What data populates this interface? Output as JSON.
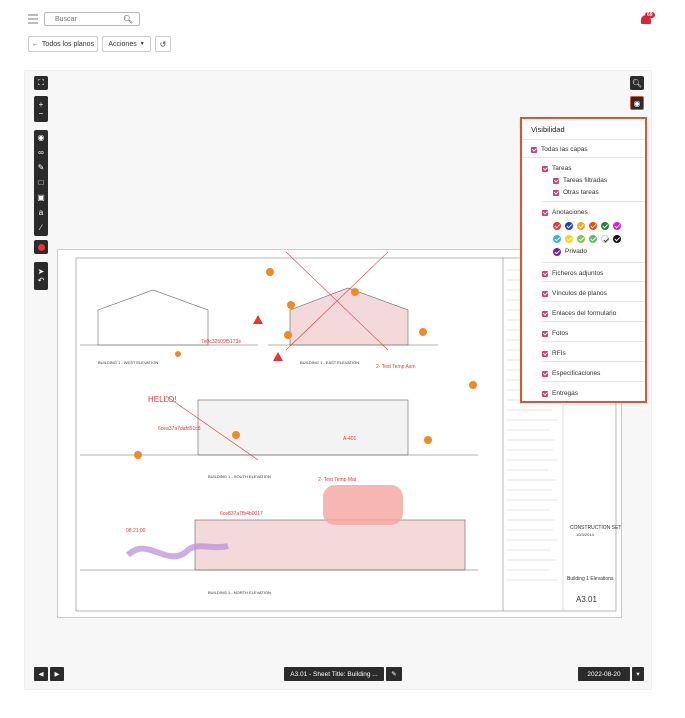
{
  "topbar": {
    "search_placeholder": "Buscar",
    "notification_count": "69"
  },
  "toolbar": {
    "back_label": "Todos los planos",
    "actions_label": "Acciones"
  },
  "sheet": {
    "title_block": {
      "set": "CONSTRUCTION SET",
      "date": "10/3/2014",
      "name": "Building 1 Elevations",
      "number": "A3.01"
    },
    "elevations": [
      "BUILDING 1 - WEST ELEVATION",
      "BUILDING 1 - EAST ELEVATION",
      "BUILDING 1 - SOUTH ELEVATION",
      "BUILDING 1 - NORTH ELEVATION"
    ],
    "markups": {
      "id1": "7e0c32509f5173e",
      "id2": "6cea37a7dafd91c8",
      "id3": "6ce837a7fb4b0017",
      "hello": "HELLO!",
      "time": "08:21:00",
      "temp1": "2- Test Temp Asm",
      "temp2": "2- Test Temp Mat",
      "a401": "A-401"
    }
  },
  "visibility": {
    "title": "Visibilidad",
    "all_layers": "Todas las capas",
    "tasks": "Tareas",
    "filtered_tasks": "Tareas filtradas",
    "other_tasks": "Otras tareas",
    "annotations": "Anotaciones",
    "private": "Privado",
    "attachments": "Ficheros adjuntos",
    "plan_links": "Vínculos de planos",
    "form_links": "Enlaces del formulario",
    "photos": "Fotos",
    "rfis": "RFIs",
    "specs": "Especificaciones",
    "deliveries": "Entregas",
    "colors_row1": [
      "#e53935",
      "#1e40c8",
      "#f5a623",
      "#e65100",
      "#2e7d32",
      "#d81bd8"
    ],
    "colors_row2": [
      "#29b6f6",
      "#f5d90a",
      "#8bc34a",
      "#66bb6a",
      "#ffffff",
      "#111111"
    ],
    "private_color": "#7b1fa2"
  },
  "bottom": {
    "sheet_label": "A3.01 - Sheet Title: Building ...",
    "date": "2022-08-20"
  }
}
